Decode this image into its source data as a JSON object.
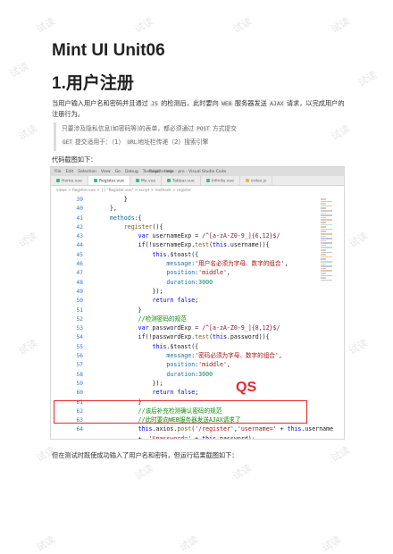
{
  "document": {
    "title": "Mint UI Unit06",
    "section_heading": "1.用户注册",
    "paragraph_1_a": "当用户输入用户名和密码并且通过 ",
    "paragraph_1_js": "JS",
    "paragraph_1_b": " 的检测后，此时要向 ",
    "paragraph_1_web": "WEB",
    "paragraph_1_c": " 服务器发送 ",
    "paragraph_1_ajax": "AJAX",
    "paragraph_1_d": " 请求，以完成用户的注册行为。",
    "quote_line_1_a": "只要涉及隐私信息(如密码等)的表单，都必须通过 ",
    "quote_line_1_post": "POST",
    "quote_line_1_b": " 方式提交",
    "quote_line_2_get": "GET",
    "quote_line_2_a": " 提交适用于：（1） ",
    "quote_line_2_url": "URL",
    "quote_line_2_b": "地址栏传递（2）搜索引擎",
    "caption_code": "代码截图如下：",
    "paragraph_2": "但在测试时既使成功输入了用户名和密码，但运行结果截图如下：",
    "annotation_label": "QS",
    "watermark": "试读"
  },
  "editor": {
    "menu": [
      "File",
      "Edit",
      "Selection",
      "View",
      "Go",
      "Debug",
      "Terminal",
      "Help"
    ],
    "window_title": "Register.vue - pro - Visual Studio Code",
    "tabs": [
      {
        "label": "Home.vue",
        "type": "vue",
        "active": false
      },
      {
        "label": "Register.vue",
        "type": "vue",
        "active": true
      },
      {
        "label": "Me.vue",
        "type": "vue",
        "active": false
      },
      {
        "label": "Tabbar.vue",
        "type": "vue",
        "active": false
      },
      {
        "label": "Infinite.vue",
        "type": "vue",
        "active": false
      },
      {
        "label": "index.js",
        "type": "js",
        "active": false
      }
    ],
    "breadcrumb": "views > Register.vue > {} \"Register.vue\" > script > methods > register",
    "lines": [
      {
        "n": "39",
        "t": "        }"
      },
      {
        "n": "40",
        "t": "    },"
      },
      {
        "n": "41",
        "t": "    methods:{"
      },
      {
        "n": "42",
        "t": "        register(){"
      },
      {
        "n": "43",
        "t": "            var usernameExp = /^[a-zA-Z0-9_]{6,12}$/"
      },
      {
        "n": "44",
        "t": "            if(!usernameExp.test(this.username)){"
      },
      {
        "n": "45",
        "t": "                this.$toast({"
      },
      {
        "n": "46",
        "t": "                    message:'用户名必须为字母、数字的组合',"
      },
      {
        "n": "47",
        "t": "                    position:'middle',"
      },
      {
        "n": "48",
        "t": "                    duration:3000"
      },
      {
        "n": "49",
        "t": "                });"
      },
      {
        "n": "50",
        "t": "                return false;"
      },
      {
        "n": "51",
        "t": "            }"
      },
      {
        "n": "52",
        "t": "            //检测密码的规范"
      },
      {
        "n": "53",
        "t": "            var passwordExp = /^[a-zA-Z0-9_]{8,12}$/"
      },
      {
        "n": "54",
        "t": "            if(!passwordExp.test(this.password)){"
      },
      {
        "n": "55",
        "t": "                this.$toast({"
      },
      {
        "n": "56",
        "t": "                    message:'密码必须为字母、数字的组合',"
      },
      {
        "n": "57",
        "t": "                    position:'middle',"
      },
      {
        "n": "58",
        "t": "                    duration:3000"
      },
      {
        "n": "59",
        "t": "                });"
      },
      {
        "n": "60",
        "t": "                return false;"
      },
      {
        "n": "61",
        "t": "            }"
      },
      {
        "n": "62",
        "t": "            //该后补充检测确认密码的规范"
      },
      {
        "n": "63",
        "t": "            //此时要向WEB服务器发送AJAX请求了"
      },
      {
        "n": "64",
        "t": "            this.axios.post('/register','username=' + this.username"
      },
      {
        "n": "",
        "t": "            +  '&password=' + this.password);"
      }
    ]
  }
}
